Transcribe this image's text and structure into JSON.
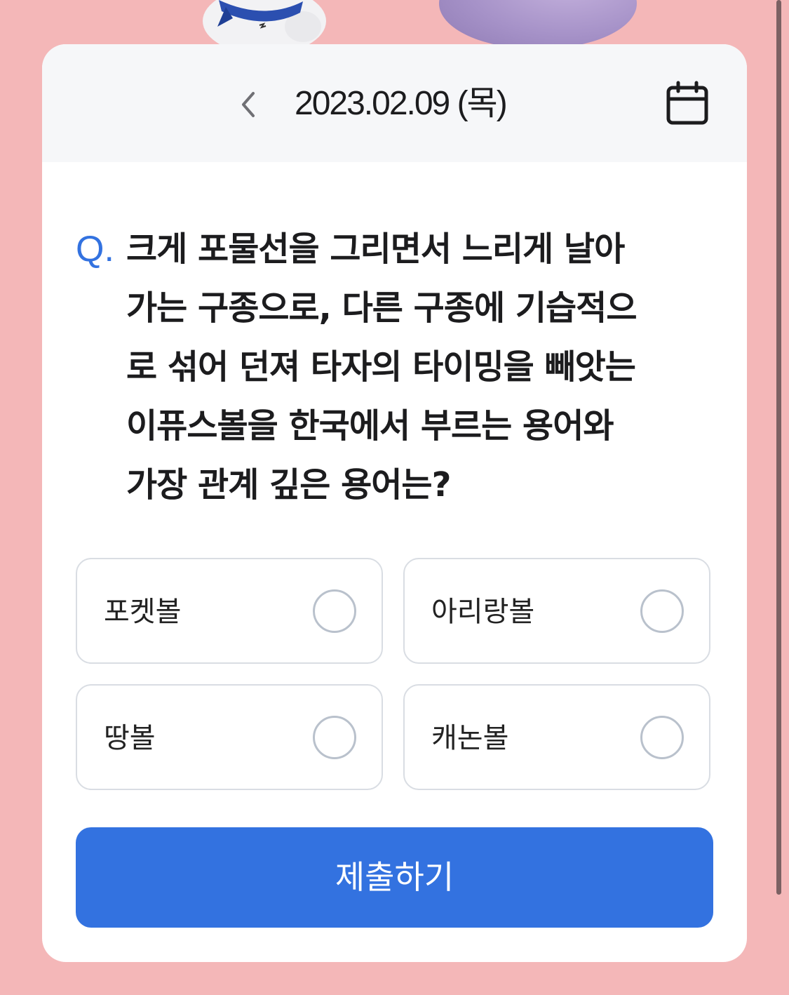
{
  "header": {
    "date": "2023.02.09 (목)",
    "prev_icon": "chevron-left-icon",
    "calendar_icon": "calendar-icon"
  },
  "question": {
    "marker": "Q.",
    "text": "크게 포물선을 그리면서 느리게 날아\n가는 구종으로, 다른 구종에 기습적으\n로 섞어 던져 타자의 타이밍을 빼앗는\n이퓨스볼을 한국에서 부르는 용어와\n가장 관계 깊은 용어는?"
  },
  "options": [
    {
      "label": "포켓볼"
    },
    {
      "label": "아리랑볼"
    },
    {
      "label": "땅볼"
    },
    {
      "label": "캐논볼"
    }
  ],
  "submit": {
    "label": "제출하기"
  },
  "colors": {
    "background": "#f4b7b8",
    "accent": "#3372e0",
    "header_bg": "#f6f7f9",
    "option_border": "#d9dde3"
  }
}
